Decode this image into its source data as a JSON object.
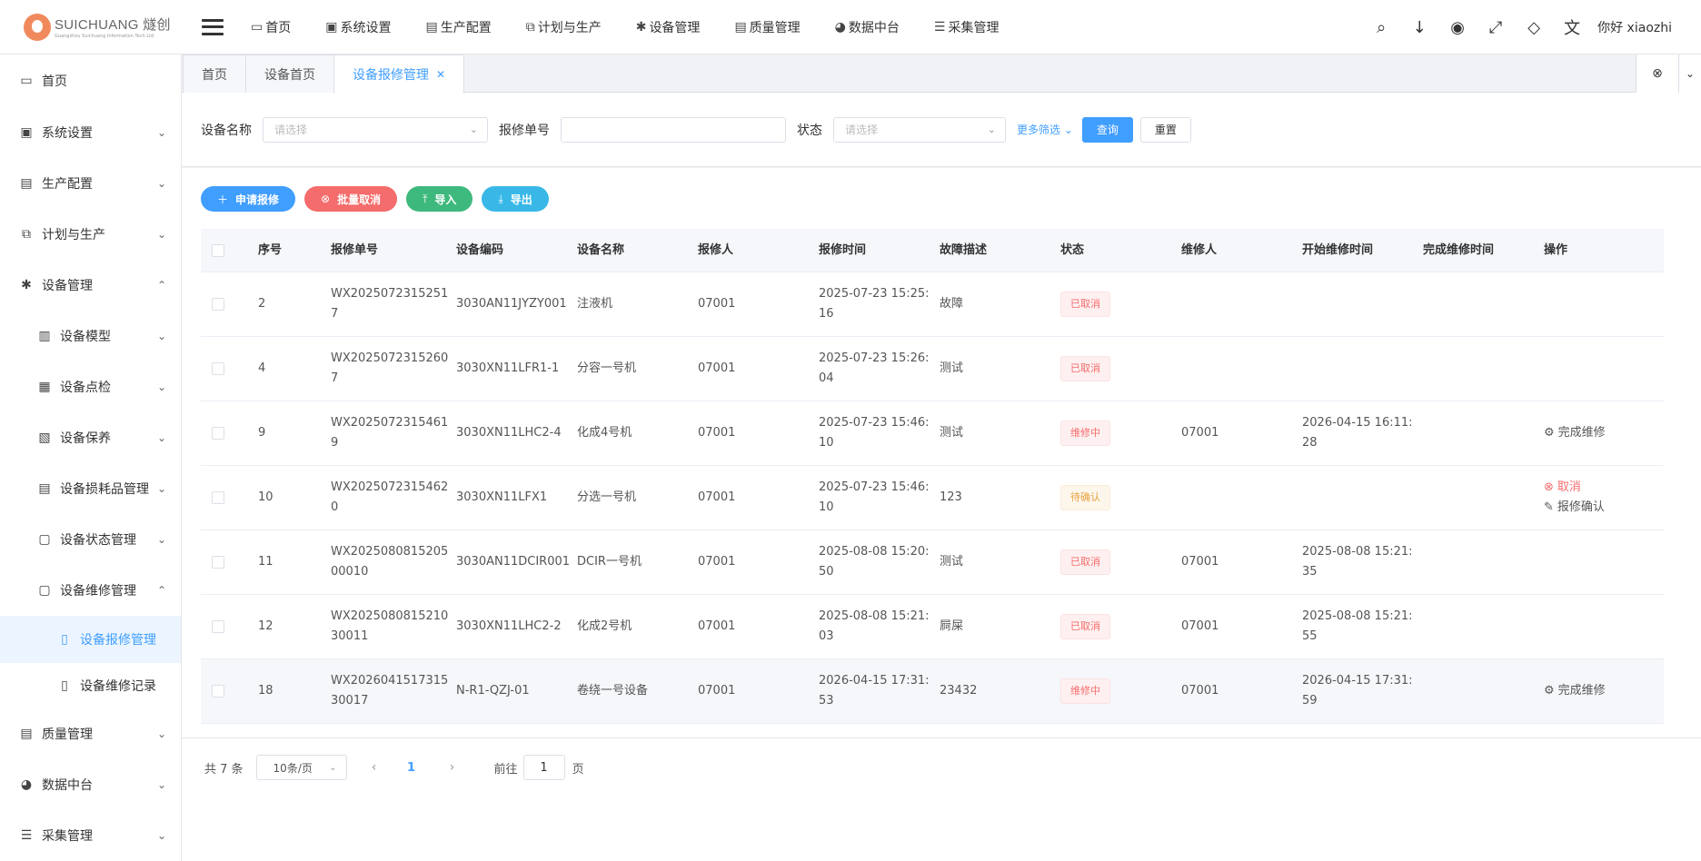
{
  "logo": {
    "main": "SUICHUANG 燧创",
    "sub": "Guangzhou Suichuang Information Tech Ltd"
  },
  "topnav": [
    {
      "label": "首页",
      "icon": "monitor-icon",
      "glyph": "▭"
    },
    {
      "label": "系统设置",
      "icon": "user-settings-icon",
      "glyph": "▣"
    },
    {
      "label": "生产配置",
      "icon": "briefcase-icon",
      "glyph": "▤"
    },
    {
      "label": "计划与生产",
      "icon": "plan-icon",
      "glyph": "⧉"
    },
    {
      "label": "设备管理",
      "icon": "asterisk-icon",
      "glyph": "✱"
    },
    {
      "label": "质量管理",
      "icon": "briefcase-icon",
      "glyph": "▤"
    },
    {
      "label": "数据中台",
      "icon": "pie-chart-icon",
      "glyph": "◕"
    },
    {
      "label": "采集管理",
      "icon": "database-icon",
      "glyph": "☰"
    }
  ],
  "topright": {
    "greeting": "你好 xiaozhi"
  },
  "sidebar": [
    {
      "label": "首页",
      "glyph": "▭",
      "icon": "monitor-icon"
    },
    {
      "label": "系统设置",
      "glyph": "▣",
      "icon": "user-settings-icon"
    },
    {
      "label": "生产配置",
      "glyph": "▤",
      "icon": "briefcase-icon"
    },
    {
      "label": "计划与生产",
      "glyph": "⧉",
      "icon": "plan-icon"
    },
    {
      "label": "设备管理",
      "glyph": "✱",
      "icon": "asterisk-icon"
    },
    {
      "label": "设备模型",
      "glyph": "▥",
      "icon": "model-icon"
    },
    {
      "label": "设备点检",
      "glyph": "▦",
      "icon": "inspection-icon"
    },
    {
      "label": "设备保养",
      "glyph": "▧",
      "icon": "maintenance-icon"
    },
    {
      "label": "设备损耗品管理",
      "glyph": "▤",
      "icon": "list-icon"
    },
    {
      "label": "设备状态管理",
      "glyph": "▢",
      "icon": "folder-icon"
    },
    {
      "label": "设备维修管理",
      "glyph": "▢",
      "icon": "folder-icon"
    },
    {
      "label": "设备报修管理",
      "glyph": "▯",
      "icon": "document-icon"
    },
    {
      "label": "设备维修记录",
      "glyph": "▯",
      "icon": "document-icon"
    },
    {
      "label": "质量管理",
      "glyph": "▤",
      "icon": "briefcase-icon"
    },
    {
      "label": "数据中台",
      "glyph": "◕",
      "icon": "pie-chart-icon"
    },
    {
      "label": "采集管理",
      "glyph": "☰",
      "icon": "database-icon"
    }
  ],
  "tabs": [
    {
      "label": "首页"
    },
    {
      "label": "设备首页"
    },
    {
      "label": "设备报修管理"
    }
  ],
  "filter": {
    "device_name_label": "设备名称",
    "device_name_placeholder": "请选择",
    "repair_no_label": "报修单号",
    "repair_no_value": "",
    "status_label": "状态",
    "status_placeholder": "请选择",
    "more": "更多筛选",
    "query": "查询",
    "reset": "重置"
  },
  "actions": {
    "apply": "申请报修",
    "batch_cancel": "批量取消",
    "import": "导入",
    "export": "导出"
  },
  "table": {
    "headers": [
      "序号",
      "报修单号",
      "设备编码",
      "设备名称",
      "报修人",
      "报修时间",
      "故障描述",
      "状态",
      "维修人",
      "开始维修时间",
      "完成维修时间",
      "操作"
    ],
    "rows": [
      {
        "seq": "2",
        "no": "WX20250723152517",
        "code": "3030AN11JYZY001",
        "name": "注液机",
        "reporter": "07001",
        "time": "2025-07-23 15:25:16",
        "desc": "故障",
        "status": "已取消",
        "status_kind": "cancel",
        "repairer": "",
        "start": "",
        "finish": "",
        "op1": "",
        "op2": ""
      },
      {
        "seq": "4",
        "no": "WX20250723152607",
        "code": "3030XN11LFR1-1",
        "name": "分容一号机",
        "reporter": "07001",
        "time": "2025-07-23 15:26:04",
        "desc": "测试",
        "status": "已取消",
        "status_kind": "cancel",
        "repairer": "",
        "start": "",
        "finish": "",
        "op1": "",
        "op2": ""
      },
      {
        "seq": "9",
        "no": "WX20250723154619",
        "code": "3030XN11LHC2-4",
        "name": "化成4号机",
        "reporter": "07001",
        "time": "2025-07-23 15:46:10",
        "desc": "测试",
        "status": "维修中",
        "status_kind": "fixing",
        "repairer": "07001",
        "start": "2026-04-15 16:11:28",
        "finish": "",
        "op1": "完成维修",
        "op2": ""
      },
      {
        "seq": "10",
        "no": "WX20250723154620",
        "code": "3030XN11LFX1",
        "name": "分选一号机",
        "reporter": "07001",
        "time": "2025-07-23 15:46:10",
        "desc": "123",
        "status": "待确认",
        "status_kind": "pending",
        "repairer": "",
        "start": "",
        "finish": "",
        "op1": "取消",
        "op2": "报修确认"
      },
      {
        "seq": "11",
        "no": "WX202508081520500010",
        "code": "3030AN11DCIR001",
        "name": "DCIR一号机",
        "reporter": "07001",
        "time": "2025-08-08 15:20:50",
        "desc": "测试",
        "status": "已取消",
        "status_kind": "cancel",
        "repairer": "07001",
        "start": "2025-08-08 15:21:35",
        "finish": "",
        "op1": "",
        "op2": ""
      },
      {
        "seq": "12",
        "no": "WX202508081521030011",
        "code": "3030XN11LHC2-2",
        "name": "化成2号机",
        "reporter": "07001",
        "time": "2025-08-08 15:21:03",
        "desc": "屙屎",
        "status": "已取消",
        "status_kind": "cancel",
        "repairer": "07001",
        "start": "2025-08-08 15:21:55",
        "finish": "",
        "op1": "",
        "op2": ""
      },
      {
        "seq": "18",
        "no": "WX202604151731530017",
        "code": "N-R1-QZJ-01",
        "name": "卷绕一号设备",
        "reporter": "07001",
        "time": "2026-04-15 17:31:53",
        "desc": "23432",
        "status": "维修中",
        "status_kind": "fixing",
        "repairer": "07001",
        "start": "2026-04-15 17:31:59",
        "finish": "",
        "op1": "完成维修",
        "op2": ""
      }
    ]
  },
  "pager": {
    "total": "共 7 条",
    "page_size": "10条/页",
    "current": "1",
    "goto_label": "前往",
    "goto_value": "1",
    "page_unit": "页"
  },
  "colors": {
    "primary": "#409eff",
    "danger": "#f56c6c",
    "success": "#3eb97d",
    "info": "#39b8e8",
    "warning": "#e6a23c"
  }
}
